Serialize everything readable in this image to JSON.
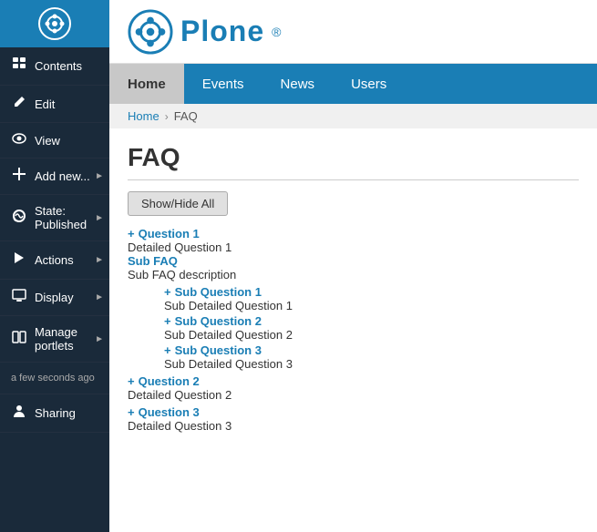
{
  "sidebar": {
    "items": [
      {
        "id": "contents",
        "label": "Contents",
        "icon": "📁",
        "hasArrow": false
      },
      {
        "id": "edit",
        "label": "Edit",
        "icon": "✏️",
        "hasArrow": false
      },
      {
        "id": "view",
        "label": "View",
        "icon": "👁",
        "hasArrow": false
      },
      {
        "id": "add-new",
        "label": "Add new...",
        "icon": "➕",
        "hasArrow": true
      },
      {
        "id": "state",
        "label": "State: Published",
        "icon": "🌐",
        "hasArrow": true
      },
      {
        "id": "actions",
        "label": "Actions",
        "icon": "⚡",
        "hasArrow": true
      },
      {
        "id": "display",
        "label": "Display",
        "icon": "🖥",
        "hasArrow": true
      },
      {
        "id": "manage-portlets",
        "label": "Manage portlets",
        "icon": "▭",
        "hasArrow": true
      },
      {
        "id": "timestamp",
        "label": "a few seconds ago",
        "icon": "",
        "hasArrow": false,
        "isTimestamp": true
      },
      {
        "id": "sharing",
        "label": "Sharing",
        "icon": "👤",
        "hasArrow": false
      }
    ]
  },
  "header": {
    "logo_alt": "Plone logo",
    "site_name": "Plone",
    "registered_symbol": "®"
  },
  "navbar": {
    "items": [
      {
        "id": "home",
        "label": "Home",
        "active": true
      },
      {
        "id": "events",
        "label": "Events",
        "active": false
      },
      {
        "id": "news",
        "label": "News",
        "active": false
      },
      {
        "id": "users",
        "label": "Users",
        "active": false
      }
    ]
  },
  "breadcrumb": {
    "home": "Home",
    "current": "FAQ"
  },
  "page": {
    "title": "FAQ",
    "show_hide_button": "Show/Hide All",
    "faq_items": [
      {
        "question": "Question 1",
        "detail": "Detailed Question 1",
        "sub_title": "Sub FAQ",
        "sub_desc": "Sub FAQ description",
        "sub_items": [
          {
            "question": "Sub Question 1",
            "detail": "Sub Detailed Question 1"
          },
          {
            "question": "Sub Question 2",
            "detail": "Sub Detailed Question 2"
          },
          {
            "question": "Sub Question 3",
            "detail": "Sub Detailed Question 3"
          }
        ]
      },
      {
        "question": "Question 2",
        "detail": "Detailed Question 2",
        "sub_title": "",
        "sub_desc": "",
        "sub_items": []
      },
      {
        "question": "Question 3",
        "detail": "Detailed Question 3",
        "sub_title": "",
        "sub_desc": "",
        "sub_items": []
      }
    ]
  }
}
